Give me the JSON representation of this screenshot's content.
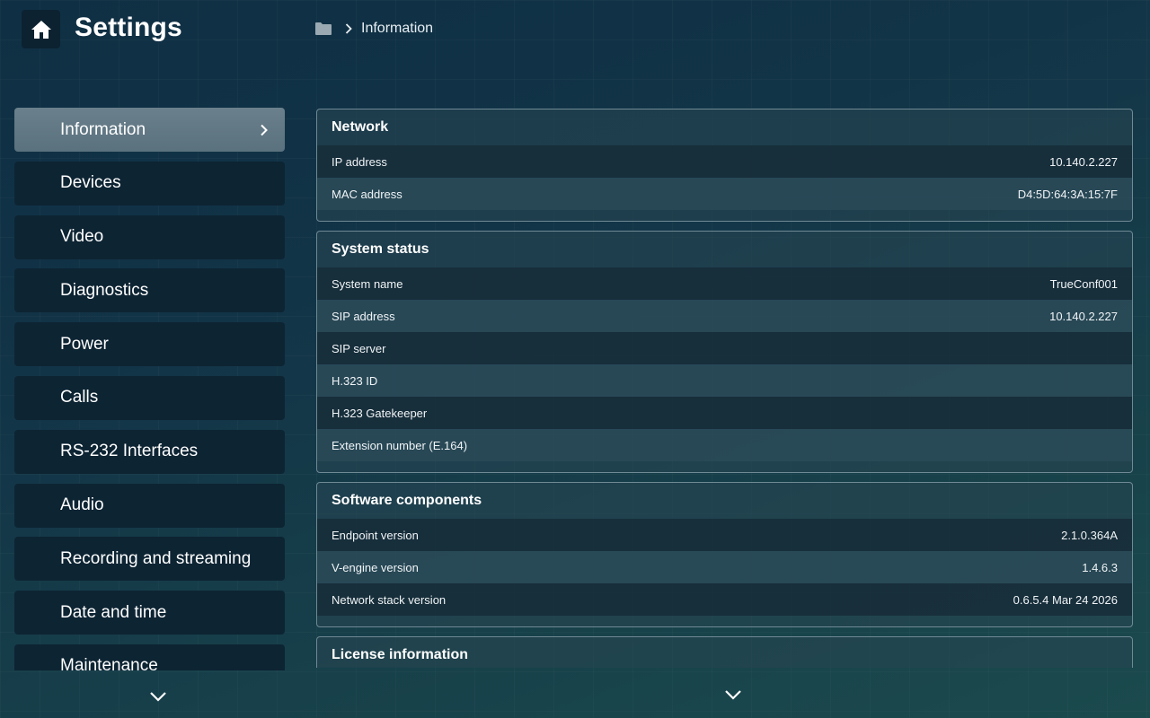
{
  "header": {
    "title": "Settings",
    "home_icon": "home-icon",
    "breadcrumb": {
      "folder_icon": "folder-icon",
      "separator_icon": "chevron-right-icon",
      "current": "Information"
    }
  },
  "sidebar": {
    "items": [
      {
        "label": "Information",
        "active": true
      },
      {
        "label": "Devices"
      },
      {
        "label": "Video"
      },
      {
        "label": "Diagnostics"
      },
      {
        "label": "Power"
      },
      {
        "label": "Calls"
      },
      {
        "label": "RS-232 Interfaces"
      },
      {
        "label": "Audio"
      },
      {
        "label": "Recording and streaming"
      },
      {
        "label": "Date and time"
      },
      {
        "label": "Maintenance"
      }
    ]
  },
  "sections": {
    "network": {
      "title": "Network",
      "rows": [
        {
          "label": "IP address",
          "value": "10.140.2.227"
        },
        {
          "label": "MAC address",
          "value": "D4:5D:64:3A:15:7F"
        }
      ]
    },
    "system_status": {
      "title": "System status",
      "rows": [
        {
          "label": "System name",
          "value": "TrueConf001"
        },
        {
          "label": "SIP address",
          "value": "10.140.2.227"
        },
        {
          "label": "SIP server",
          "value": ""
        },
        {
          "label": "H.323 ID",
          "value": ""
        },
        {
          "label": "H.323 Gatekeeper",
          "value": ""
        },
        {
          "label": "Extension number (E.164)",
          "value": ""
        }
      ]
    },
    "software": {
      "title": "Software components",
      "rows": [
        {
          "label": "Endpoint version",
          "value": "2.1.0.364A"
        },
        {
          "label": "V-engine version",
          "value": "1.4.6.3"
        },
        {
          "label": "Network stack version",
          "value": "0.6.5.4 Mar 24 2026"
        }
      ]
    },
    "license": {
      "title": "License information"
    }
  },
  "colors": {
    "accent_active": "#5f7683",
    "item_bg": "#0d2433",
    "panel_border": "#6f8995"
  }
}
